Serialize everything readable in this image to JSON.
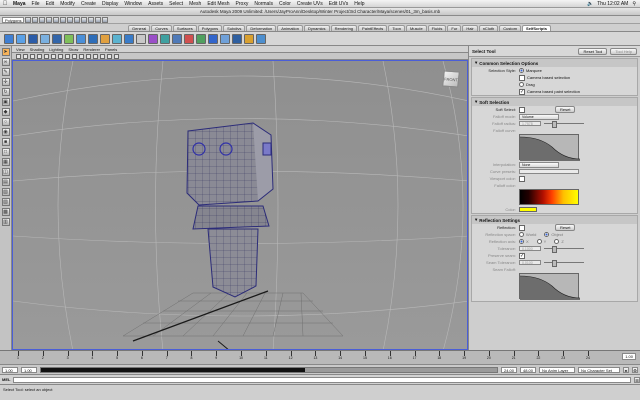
{
  "menubar": {
    "app": "Maya",
    "items": [
      "File",
      "Edit",
      "Modify",
      "Create",
      "Display",
      "Window",
      "Assets",
      "Select",
      "Mesh",
      "Edit Mesh",
      "Proxy",
      "Normals",
      "Color",
      "Create UVs",
      "Edit UVs",
      "Help"
    ],
    "clock": "Thu 12:02 AM"
  },
  "window": {
    "title": "Autodesk Maya 2009 Unlimited: /Users/JayProAnn/Desktop/Winter Project/3rd Character/Maya/scenes/01_3m_basis.mb"
  },
  "status_line": {
    "mode": "Polygons"
  },
  "shelf": {
    "tabs": [
      "General",
      "Curves",
      "Surfaces",
      "Polygons",
      "Subdivs",
      "Deformation",
      "Animation",
      "Dynamics",
      "Rendering",
      "PaintEffects",
      "Toon",
      "Muscle",
      "Fluids",
      "Fur",
      "Hair",
      "nCloth",
      "Custom",
      "SelfScripts"
    ],
    "active_tab": "SelfScripts",
    "tool_labels": [
      "Obj",
      "Fbx",
      "Ref",
      "Cr",
      "c",
      "curv",
      "Locat",
      "ProE",
      "ID",
      "ST",
      "P1",
      "P2"
    ]
  },
  "viewport": {
    "menus": [
      "View",
      "Shading",
      "Lighting",
      "Show",
      "Renderer",
      "Panels"
    ],
    "viewcube_label": "FRONT"
  },
  "tool_settings": {
    "title": "Select Tool",
    "reset_label": "Reset Tool",
    "help_label": "Tool Help",
    "common": {
      "title": "Common Selection Options",
      "style_label": "Selection Style:",
      "marquee": "Marquee",
      "camera_based": "Camera based selection",
      "drag": "Drag",
      "camera_paint": "Camera based paint selection"
    },
    "soft": {
      "title": "Soft Selection",
      "soft_select": "Soft Select:",
      "reset": "Reset",
      "falloff_mode": "Falloff mode:",
      "falloff_mode_value": "Volume",
      "falloff_radius": "Falloff radius:",
      "falloff_radius_value": "1.7578",
      "falloff_curve": "Falloff curve:",
      "interpolation": "Interpolation:",
      "interpolation_value": "None",
      "curve_presets": "Curve presets:",
      "viewport_color": "Viewport color:",
      "falloff_color": "Falloff color:",
      "color": "Color:"
    },
    "reflection": {
      "title": "Reflection Settings",
      "reflection": "Reflection:",
      "reset": "Reset",
      "space": "Reflection space:",
      "world": "World",
      "object": "Object",
      "axis": "Reflection axis:",
      "x": "X",
      "y": "Y",
      "z": "Z",
      "tolerance": "Tolerance:",
      "tolerance_value": "0.1000",
      "preserve_seam": "Preserve seam:",
      "seam_tolerance": "Seam Tolerance:",
      "seam_tolerance_value": "0.0100",
      "seam_falloff": "Seam Falloff:"
    },
    "colors": {
      "color_swatch": "#ffff00"
    }
  },
  "timeline": {
    "ticks": [
      "1",
      "2",
      "3",
      "4",
      "5",
      "6",
      "7",
      "8",
      "9",
      "10",
      "11",
      "12",
      "13",
      "14",
      "15",
      "16",
      "17",
      "18",
      "19",
      "20",
      "21",
      "22",
      "23",
      "24"
    ],
    "current_frame": "1.00"
  },
  "range": {
    "start": "1.00",
    "start_inner": "1.00",
    "end_inner": "24.00",
    "end": "48.00",
    "anim_layer": "No Anim Layer",
    "character_set": "No Character Set"
  },
  "command_line": {
    "label": "MEL"
  },
  "help_line": {
    "text": "Select Tool: select an object"
  }
}
